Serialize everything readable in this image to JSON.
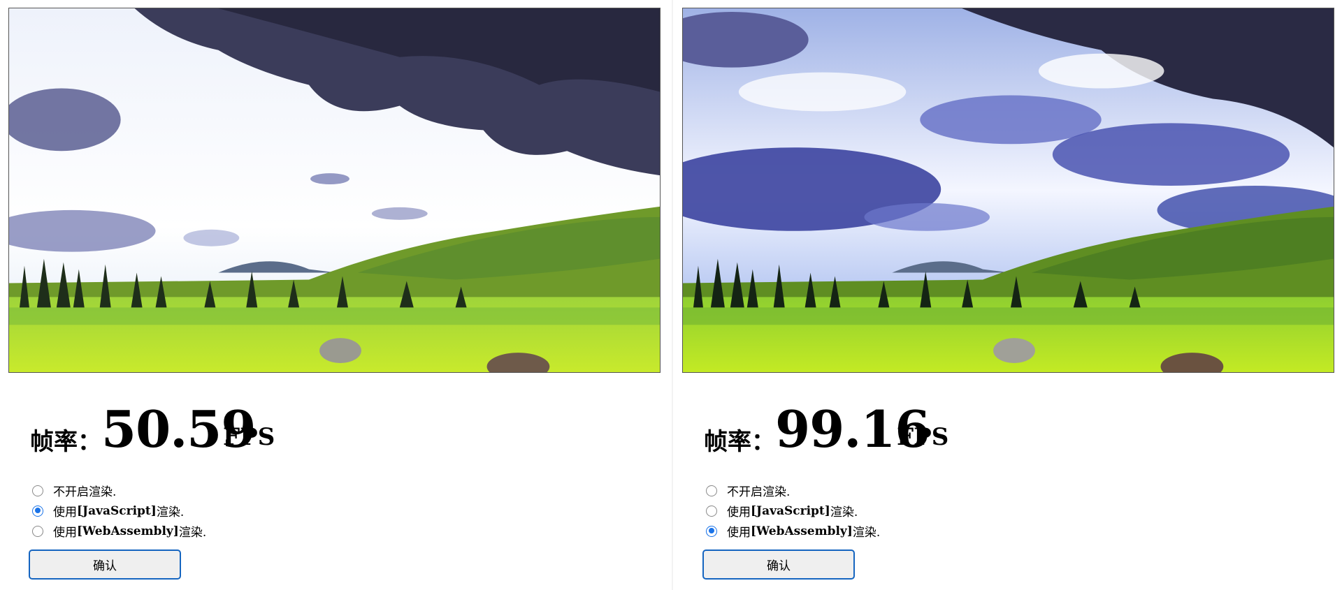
{
  "panels": [
    {
      "fps_label": "帧率：",
      "fps_value": "50.59",
      "fps_unit": "FPS",
      "options": [
        {
          "label": "不开启渲染.",
          "checked": false
        },
        {
          "prefix": "使用 ",
          "tech": "[JavaScript]",
          "suffix": " 渲染.",
          "checked": true
        },
        {
          "prefix": "使用 ",
          "tech": "[WebAssembly]",
          "suffix": " 渲染.",
          "checked": false
        }
      ],
      "confirm_label": "确认",
      "video": "landscape-bright"
    },
    {
      "fps_label": "帧率：",
      "fps_value": "99.16",
      "fps_unit": "FPS",
      "options": [
        {
          "label": "不开启渲染.",
          "checked": false
        },
        {
          "prefix": "使用 ",
          "tech": "[JavaScript]",
          "suffix": " 渲染.",
          "checked": false
        },
        {
          "prefix": "使用 ",
          "tech": "[WebAssembly]",
          "suffix": " 渲染.",
          "checked": true
        }
      ],
      "confirm_label": "确认",
      "video": "landscape-filtered"
    }
  ],
  "colors": {
    "accent": "#1a73e8",
    "button_border": "#1565c0"
  }
}
